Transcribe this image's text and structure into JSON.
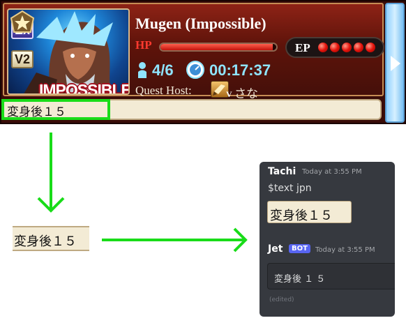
{
  "raid": {
    "name": "Mugen (Impossible)",
    "badge_ex": "Ex",
    "badge_v2": "V2",
    "difficulty": "IMPOSSIBLE",
    "hp_label": "HP",
    "hp_fraction": 0.97,
    "ep_label": "EP",
    "ep_dots": 5,
    "players": "4/6",
    "timer": "00:17:37",
    "host_label": "Quest Host:",
    "host_rank_mark": "V",
    "host_name": "さな",
    "boss_name_text": "変身後１５",
    "colors": {
      "highlight": "#19dc19",
      "hp": "#e4130b",
      "ep_dot": "#e4130b"
    }
  },
  "crop": {
    "text": "変身後１５"
  },
  "discord": {
    "message1": {
      "username": "Tachi",
      "timestamp": "Today at 3:55 PM",
      "text": "$text jpn",
      "image_text": "変身後１５"
    },
    "message2": {
      "username": "Jet",
      "badge": "BOT",
      "timestamp": "Today at 3:55 PM",
      "embed_text": "変身後 １ ５",
      "edited": "(edited)"
    },
    "colors": {
      "background": "#36393f",
      "bot_badge": "#5865f2"
    }
  },
  "icons": [
    "star-emblem-icon",
    "players-icon",
    "timer-icon",
    "host-avatar-icon",
    "scroll-arrow-icon",
    "down-arrow-icon",
    "right-arrow-icon"
  ]
}
